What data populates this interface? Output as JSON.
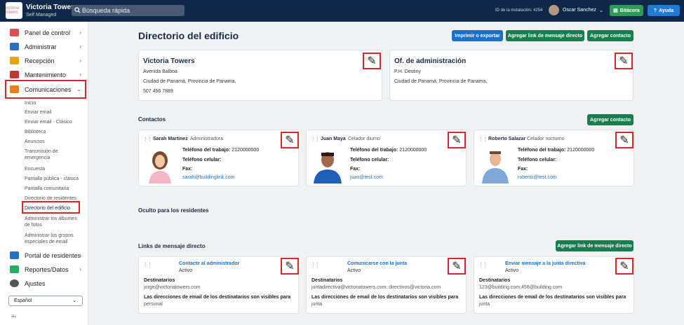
{
  "topbar": {
    "title": "Victoria Towers",
    "subtitle": "Self Managed",
    "logo_text": "victoria towers",
    "search_placeholder": "Búsqueda rápida",
    "installation": "ID de la instalación: 4254",
    "user": "Oscar Sanchez",
    "bitacora": "Bitácora",
    "help": "Ayuda"
  },
  "sidebar": {
    "items": [
      {
        "label": "Panel de control",
        "icon": "dashboard-icon",
        "color": "#d9534f"
      },
      {
        "label": "Administrar",
        "icon": "buildings-icon",
        "color": "#2a6fc0"
      },
      {
        "label": "Recepción",
        "icon": "bell-icon",
        "color": "#e5a21a"
      },
      {
        "label": "Mantenimiento",
        "icon": "toolbox-icon",
        "color": "#c0392b"
      },
      {
        "label": "Comunicaciones",
        "icon": "megaphone-icon",
        "color": "#e67e22"
      },
      {
        "label": "Portal de residentes",
        "icon": "portal-icon",
        "color": "#2a6fc0"
      },
      {
        "label": "Reportes/Datos",
        "icon": "chart-icon",
        "color": "#27ae60"
      },
      {
        "label": "Ajustes",
        "icon": "gear-icon",
        "color": "#555555"
      }
    ],
    "subitems": [
      "Inicio",
      "Enviar email",
      "Enviar email - Clásico",
      "Biblioteca",
      "Anuncios",
      "Transmisión de emergencia",
      "Encuesta",
      "Pantalla pública - clásica",
      "Pantalla comunitaria",
      "Directorio de residentes",
      "Directorio del edificio",
      "Administrar los álbumes de fotos",
      "Administrar los grupos especiales de email"
    ],
    "language": "Español"
  },
  "page": {
    "title": "Directorio del edificio",
    "btn_print": "Imprimir o exportar",
    "btn_add_link": "Agregar link de mensaje directo",
    "btn_add_contact": "Agregar contacto"
  },
  "buildings": [
    {
      "title": "Victoria Towers",
      "lines": [
        "Avenida Balboa",
        "Ciudad de Panamá, Provincia de Panama,",
        "507 456 7889"
      ]
    },
    {
      "title": "Of. de administración",
      "lines": [
        "P.H. Destiny",
        "Ciudad de Panamá, Provincia de Panama,"
      ]
    }
  ],
  "contacts": {
    "heading": "Contactos",
    "add": "Agregar contacto",
    "work_label": "Teléfono del trabajo:",
    "cell_label": "Teléfono celular:",
    "fax_label": "Fax:",
    "items": [
      {
        "name": "Sarah Martinez",
        "role": "Administradora",
        "work": "2120000000",
        "email": "sarah@buildinglink.com"
      },
      {
        "name": "Juan Maya",
        "role": "Celador diurno",
        "work": "2120000000",
        "email": "juan@test.com"
      },
      {
        "name": "Roberto Salazar",
        "role": "Celador nocturno",
        "work": "2120000000",
        "email": "roberto@test.com"
      }
    ]
  },
  "hidden": {
    "heading": "Oculto para los residentes"
  },
  "links": {
    "heading": "Links de mensaje directo",
    "add": "Agregar link de mensaje directo",
    "recipients_label": "Destinatarios",
    "visibility_label": "Las direcciones de email de los destinatarios son visibles para",
    "items": [
      {
        "title": "Contacte al administrador",
        "status": "Activo",
        "recipients": "jorge@victoriatowers.com",
        "visible": "personal"
      },
      {
        "title": "Comunicarse con la junta",
        "status": "Activo",
        "recipients": "juntadirectiva@victoriatowers.com; directivos@victoria.com",
        "visible": "junta"
      },
      {
        "title": "Enviar mensaje a la junta directiva",
        "status": "Activo",
        "recipients": "123@building.com;456@building.com",
        "visible": "junta"
      }
    ]
  }
}
